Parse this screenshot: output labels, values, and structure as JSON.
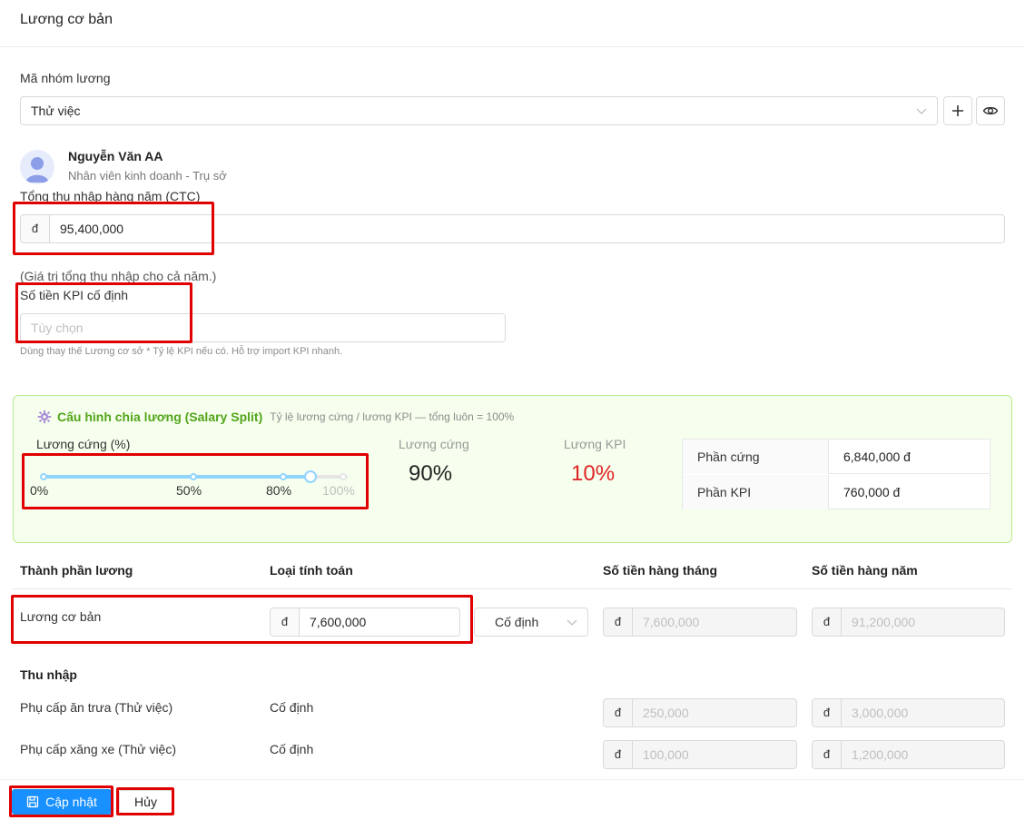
{
  "header": {
    "title": "Lương cơ bản"
  },
  "salary_group": {
    "label": "Mã nhóm lương",
    "value": "Thử việc"
  },
  "employee": {
    "name": "Nguyễn Văn AA",
    "role": "Nhân viên kinh doanh - Trụ sở"
  },
  "ctc": {
    "label": "Tổng thu nhập hàng năm (CTC)",
    "currency": "đ",
    "value": "95,400,000",
    "note": "(Giá trị tổng thu nhập cho cả năm.)"
  },
  "kpi_fixed": {
    "label": "Số tiền KPI cố định",
    "placeholder": "Tùy chọn",
    "hint": "Dùng thay thế Lương cơ sở * Tỷ lệ KPI nếu có. Hỗ trợ import KPI nhanh."
  },
  "split": {
    "title": "Cấu hình chia lương (Salary Split)",
    "subtitle": "Tỷ lệ lương cứng / lương KPI — tổng luôn = 100%",
    "slider_label": "Lương cứng (%)",
    "slider_value_percent": 90,
    "marks": [
      "0%",
      "50%",
      "80%",
      "100%"
    ],
    "hard_label": "Lương cứng",
    "hard_value": "90%",
    "kpi_label": "Lương KPI",
    "kpi_value": "10%",
    "summary": [
      {
        "key": "Phần cứng",
        "value": "6,840,000 đ"
      },
      {
        "key": "Phần KPI",
        "value": "760,000 đ"
      }
    ]
  },
  "table": {
    "headers": [
      "Thành phần lương",
      "Loại tính toán",
      "Số tiền hàng tháng",
      "Số tiền hàng năm"
    ],
    "base": {
      "label": "Lương cơ bản",
      "currency": "đ",
      "value": "7,600,000",
      "calc_type": "Cố định",
      "monthly": "7,600,000",
      "annual": "91,200,000"
    },
    "income_section": "Thu nhập",
    "income_rows": [
      {
        "label": "Phụ cấp ăn trưa (Thử việc)",
        "calc_type": "Cố định",
        "monthly": "250,000",
        "annual": "3,000,000"
      },
      {
        "label": "Phụ cấp xăng xe (Thử việc)",
        "calc_type": "Cố định",
        "monthly": "100,000",
        "annual": "1,200,000"
      }
    ]
  },
  "footer": {
    "update_label": "Cập nhật",
    "cancel_label": "Hủy"
  },
  "colors": {
    "primary": "#1890ff",
    "success": "#52a41a",
    "danger": "#e02424",
    "highlight": "#e00000"
  }
}
